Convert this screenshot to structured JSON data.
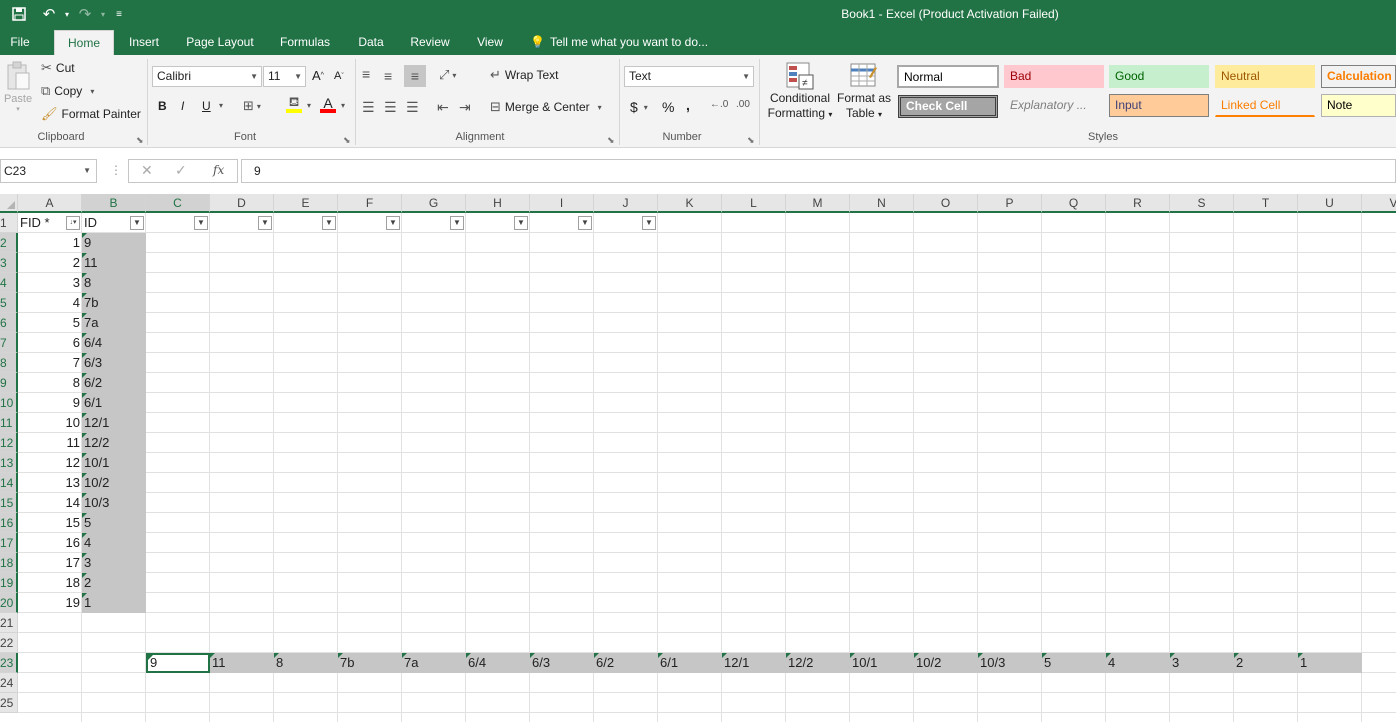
{
  "window": {
    "title": "Book1 - Excel (Product Activation Failed)"
  },
  "tabs": [
    "File",
    "Home",
    "Insert",
    "Page Layout",
    "Formulas",
    "Data",
    "Review",
    "View"
  ],
  "tell_me": "Tell me what you want to do...",
  "clipboard": {
    "paste": "Paste",
    "cut": "Cut",
    "copy": "Copy",
    "format_painter": "Format Painter",
    "label": "Clipboard"
  },
  "font": {
    "name": "Calibri",
    "size": "11",
    "bold": "B",
    "italic": "I",
    "underline": "U",
    "label": "Font"
  },
  "alignment": {
    "wrap_text": "Wrap Text",
    "merge_center": "Merge & Center",
    "label": "Alignment"
  },
  "number": {
    "format": "Text",
    "currency": "$",
    "percent": "%",
    "comma": ",",
    "label": "Number"
  },
  "styles": {
    "conditional": [
      "Conditional",
      "Formatting"
    ],
    "format_table": [
      "Format as",
      "Table"
    ],
    "gallery": [
      "Normal",
      "Bad",
      "Good",
      "Neutral",
      "Calculation",
      "Check Cell",
      "Explanatory ...",
      "Input",
      "Linked Cell",
      "Note"
    ],
    "label": "Styles"
  },
  "formula_bar": {
    "name_box": "C23",
    "value": "9"
  },
  "columns": [
    "A",
    "B",
    "C",
    "D",
    "E",
    "F",
    "G",
    "H",
    "I",
    "J",
    "K",
    "L",
    "M",
    "N",
    "O",
    "P",
    "Q",
    "R",
    "S",
    "T",
    "U",
    "V"
  ],
  "rows": [
    "1",
    "2",
    "3",
    "4",
    "5",
    "6",
    "7",
    "8",
    "9",
    "10",
    "11",
    "12",
    "13",
    "14",
    "15",
    "16",
    "17",
    "18",
    "19",
    "20",
    "21",
    "22",
    "23",
    "24",
    "25"
  ],
  "header_row": {
    "a": "FID *",
    "b": "ID"
  },
  "fid": [
    "1",
    "2",
    "3",
    "4",
    "5",
    "6",
    "7",
    "8",
    "9",
    "10",
    "11",
    "12",
    "13",
    "14",
    "15",
    "16",
    "17",
    "18",
    "19"
  ],
  "ids": [
    "9",
    "11",
    "8",
    "7b",
    "7a",
    "6/4",
    "6/3",
    "6/2",
    "6/1",
    "12/1",
    "12/2",
    "10/1",
    "10/2",
    "10/3",
    "5",
    "4",
    "3",
    "2",
    "1"
  ],
  "row23": [
    "9",
    "11",
    "8",
    "7b",
    "7a",
    "6/4",
    "6/3",
    "6/2",
    "6/1",
    "12/1",
    "12/2",
    "10/1",
    "10/2",
    "10/3",
    "5",
    "4",
    "3",
    "2",
    "1"
  ],
  "colors": {
    "brand": "#217346",
    "selection": "#c6c6c6"
  }
}
